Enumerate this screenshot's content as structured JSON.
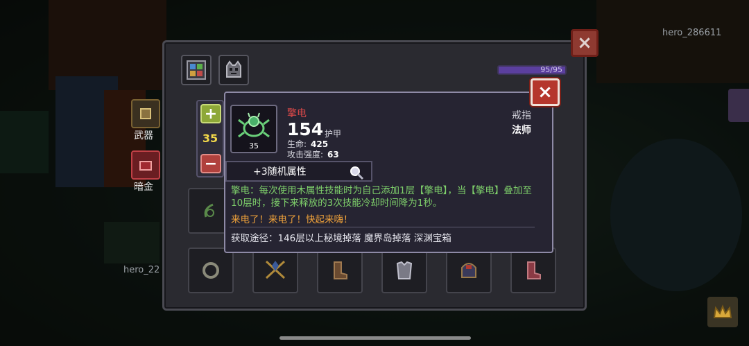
{
  "player_names": [
    "hero_286611",
    "hero_22"
  ],
  "side_labels": {
    "weapon": "武器",
    "gold": "暗金"
  },
  "inventory": {
    "capacity": "95/95",
    "capacity_fill_fraction": 1.0
  },
  "stepper": {
    "value": "35",
    "plus": "+",
    "minus": "−"
  },
  "close_icon": "×",
  "item": {
    "name": "擎电",
    "level": "35",
    "main_stat_value": "154",
    "main_stat_label": "护甲",
    "sub_stats": [
      {
        "label": "生命:",
        "value": "425"
      },
      {
        "label": "攻击强度:",
        "value": "63"
      }
    ],
    "type": "戒指",
    "class": "法师",
    "random_attrs": "+3随机属性",
    "description": "擎电：每次使用木属性技能时为自己添加1层【擎电】，当【擎电】叠加至10层时，接下来释放的3次技能冷却时间降为1秒。",
    "flavor": "来电了！来电了！快起来嗨！",
    "source": "获取途径：146层以上秘境掉落 魔界岛掉落 深渊宝箱"
  },
  "colors": {
    "item_name": "#e24a4a",
    "description": "#7fd16b",
    "flavor": "#f0a23a",
    "stepper_value": "#f2d84a",
    "close_red": "#b5362c"
  },
  "icons": {
    "tabs": [
      "backpack-grid-icon",
      "ghost-mask-icon"
    ],
    "item": "green-beetle-ring-icon",
    "magnifier": "magnifier-icon",
    "slots_bottom": [
      "ring-icon",
      "crossbow-icon",
      "boots-icon",
      "armor-icon",
      "helmet-icon",
      "boots-red-icon"
    ]
  }
}
